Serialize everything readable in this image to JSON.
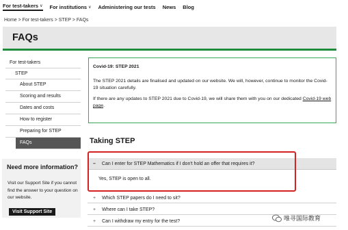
{
  "topnav": {
    "items": [
      {
        "label": "For test-takers",
        "dropdown": true,
        "active": true
      },
      {
        "label": "For institutions",
        "dropdown": true,
        "active": false
      },
      {
        "label": "Administering our tests",
        "dropdown": false,
        "active": false
      },
      {
        "label": "News",
        "dropdown": false,
        "active": false
      },
      {
        "label": "Blog",
        "dropdown": false,
        "active": false
      }
    ]
  },
  "breadcrumb": "Home > For test-takers > STEP > FAQs",
  "page_title": "FAQs",
  "sidebar": {
    "root": "For test-takers",
    "section": "STEP",
    "items": [
      "About STEP",
      "Scoring and results",
      "Dates and costs",
      "How to register",
      "Preparing for STEP",
      "FAQs"
    ],
    "current": "FAQs"
  },
  "info_box": {
    "title": "Need more information?",
    "text": "Visit our Support Site if you cannot find the answer to your question on our website.",
    "button": "Visit Support Site"
  },
  "covid_notice": {
    "title": "Covid-19: STEP 2021",
    "para1": "The STEP 2021 details are finalised and updated on our website. We will, however, continue to monitor the Covid-19 situation carefully.",
    "para2_prefix": "If there are any updates to STEP 2021 due to Covid-19, we will share them with you on our dedicated",
    "link": "Covid-19 web page",
    "para2_suffix": "."
  },
  "section_title": "Taking STEP",
  "faq": {
    "open_symbol": "–",
    "closed_symbol": "+",
    "open_question": "Can I enter for STEP Mathematics if I don't hold an offer that requires it?",
    "open_answer": "Yes, STEP is open to all.",
    "questions": [
      "Which STEP papers do I need to sit?",
      "Where can I take STEP?",
      "Can I withdraw my entry for the test?"
    ]
  },
  "watermark": "唯寻国际教育",
  "colors": {
    "accent_green": "#1e8c3a",
    "highlight_red": "#d42020",
    "banner_gray": "#e7e7e7"
  }
}
